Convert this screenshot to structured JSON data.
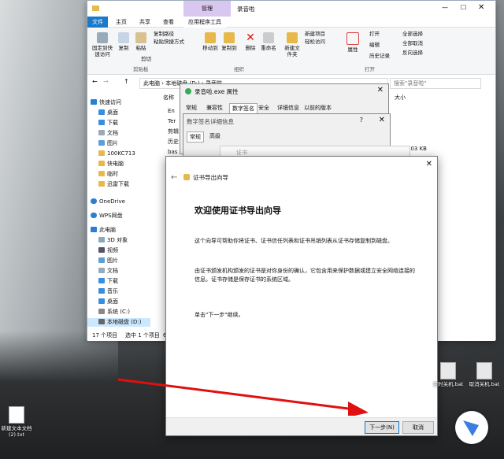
{
  "explorer": {
    "title_tab_manage": "管理",
    "title": "录音啦",
    "tabs": [
      "文件",
      "主页",
      "共享",
      "查看",
      "应用程序工具"
    ],
    "ribbon": {
      "pin_label": "固定到快速访问",
      "copy_label": "复制",
      "paste_label": "粘贴",
      "copy_path_label": "复制路径",
      "paste_shortcut_label": "粘贴快捷方式",
      "cut_label": "剪切",
      "move_to_label": "移动到",
      "copy_to_label": "复制到",
      "delete_label": "删除",
      "rename_label": "重命名",
      "new_item_label": "新建项目",
      "easy_access_label": "轻松访问",
      "new_folder_label": "新建文件夹",
      "properties_label": "属性",
      "open_label": "打开",
      "edit_label": "编辑",
      "history_label": "历史记录",
      "select_all_label": "全部选择",
      "select_none_label": "全部取消",
      "invert_label": "反向选择",
      "group_clipboard": "剪贴板",
      "group_organize": "组织",
      "group_open": "打开"
    },
    "address": [
      "此电脑",
      "本地磁盘 (D:)",
      "录音啦"
    ],
    "search_placeholder": "搜索\"录音啦\"",
    "column_name": "名称",
    "column_size": "大小",
    "file_names": [
      "En",
      "Ter",
      "剪辑",
      "历史",
      "bas",
      "bas"
    ],
    "sizes": [
      "103 KB",
      "14 KB"
    ],
    "nav": [
      "快速访问",
      "桌面",
      "下载",
      "文档",
      "图片",
      "100KC713",
      "快电脑",
      "临时",
      "迅雷下载",
      "OneDrive",
      "WPS网盘",
      "此电脑",
      "3D 对象",
      "视频",
      "图片",
      "文档",
      "下载",
      "音乐",
      "桌面",
      "系统 (C:)",
      "本地磁盘 (D:)"
    ],
    "status_count": "17 个项目",
    "status_selected": "选中 1 个项目",
    "status_trunc": "6"
  },
  "props_dialog": {
    "title": "录音啦.exe 属性",
    "tabs": [
      "常规",
      "兼容性",
      "数字签名",
      "安全",
      "详细信息",
      "以前的版本"
    ]
  },
  "detail_dialog": {
    "title": "数字签名详细信息",
    "help": "?",
    "tabs": [
      "常规",
      "高级"
    ],
    "trunc": "证书"
  },
  "wizard": {
    "caption": "证书导出向导",
    "heading": "欢迎使用证书导出向导",
    "p1": "这个向导可帮助你将证书、证书信任列表和证书吊销列表从证书存储复制到磁盘。",
    "p2": "由证书颁发机构颁发的证书是对你身份的确认，它包含用来保护数据或建立安全网络连接的信息。证书存储是保存证书的系统区域。",
    "p3": "单击\"下一步\"继续。",
    "next_label": "下一步(N)",
    "cancel_label": "取消"
  },
  "desktop": {
    "icon1": "定时关机.bat",
    "icon2": "取消关机.bat",
    "icon3": "新建文本文档",
    "icon3_sub": "(2).txt"
  }
}
